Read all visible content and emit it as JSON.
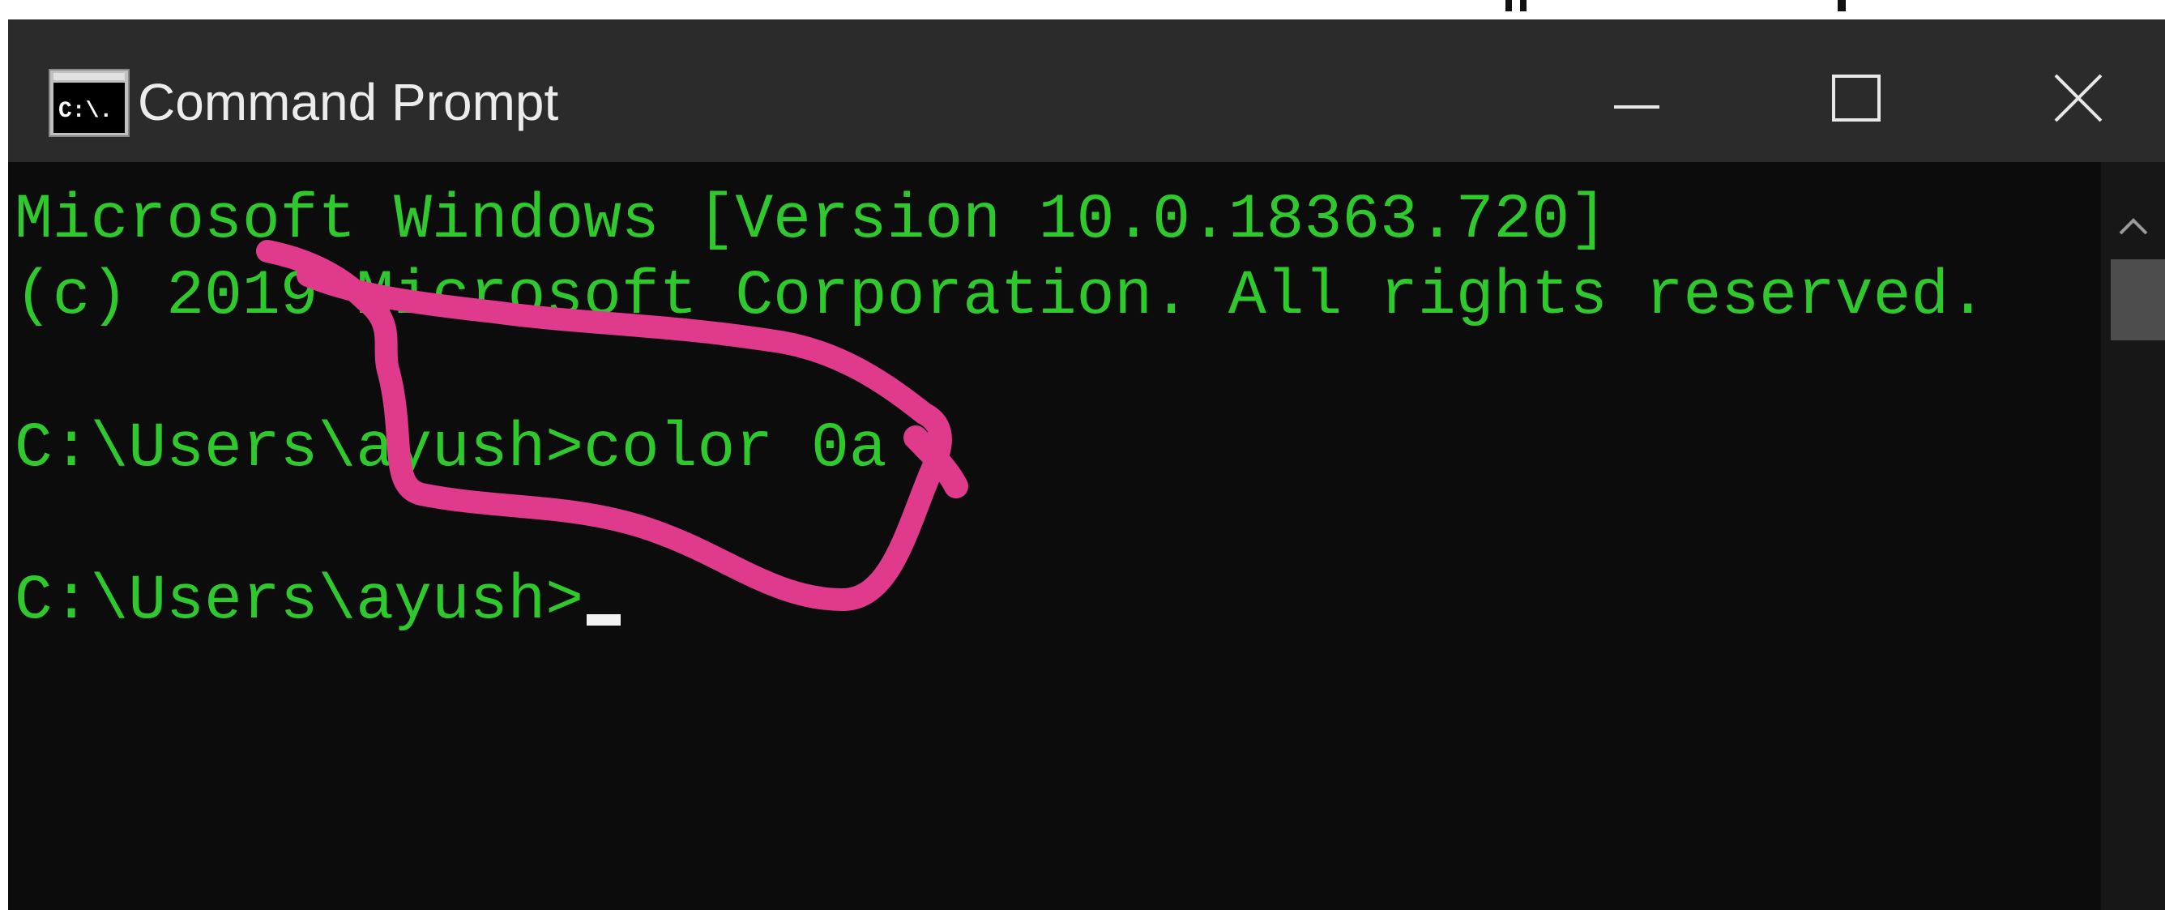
{
  "window": {
    "title": "Command Prompt",
    "icon_text": "C:\\."
  },
  "controls": {
    "minimize_icon": "minimize-icon",
    "maximize_icon": "maximize-icon",
    "close_icon": "close-icon"
  },
  "console": {
    "lines": [
      "Microsoft Windows [Version 10.0.18363.720]",
      "(c) 2019 Microsoft Corporation. All rights reserved.",
      "",
      "C:\\Users\\ayush>color 0a",
      "",
      "C:\\Users\\ayush>"
    ],
    "text_color": "#2fc92d",
    "background_color": "#0c0c0c"
  },
  "annotation": {
    "color": "#e03a8c",
    "shape": "hand-drawn loop around 'color 0a' command"
  }
}
